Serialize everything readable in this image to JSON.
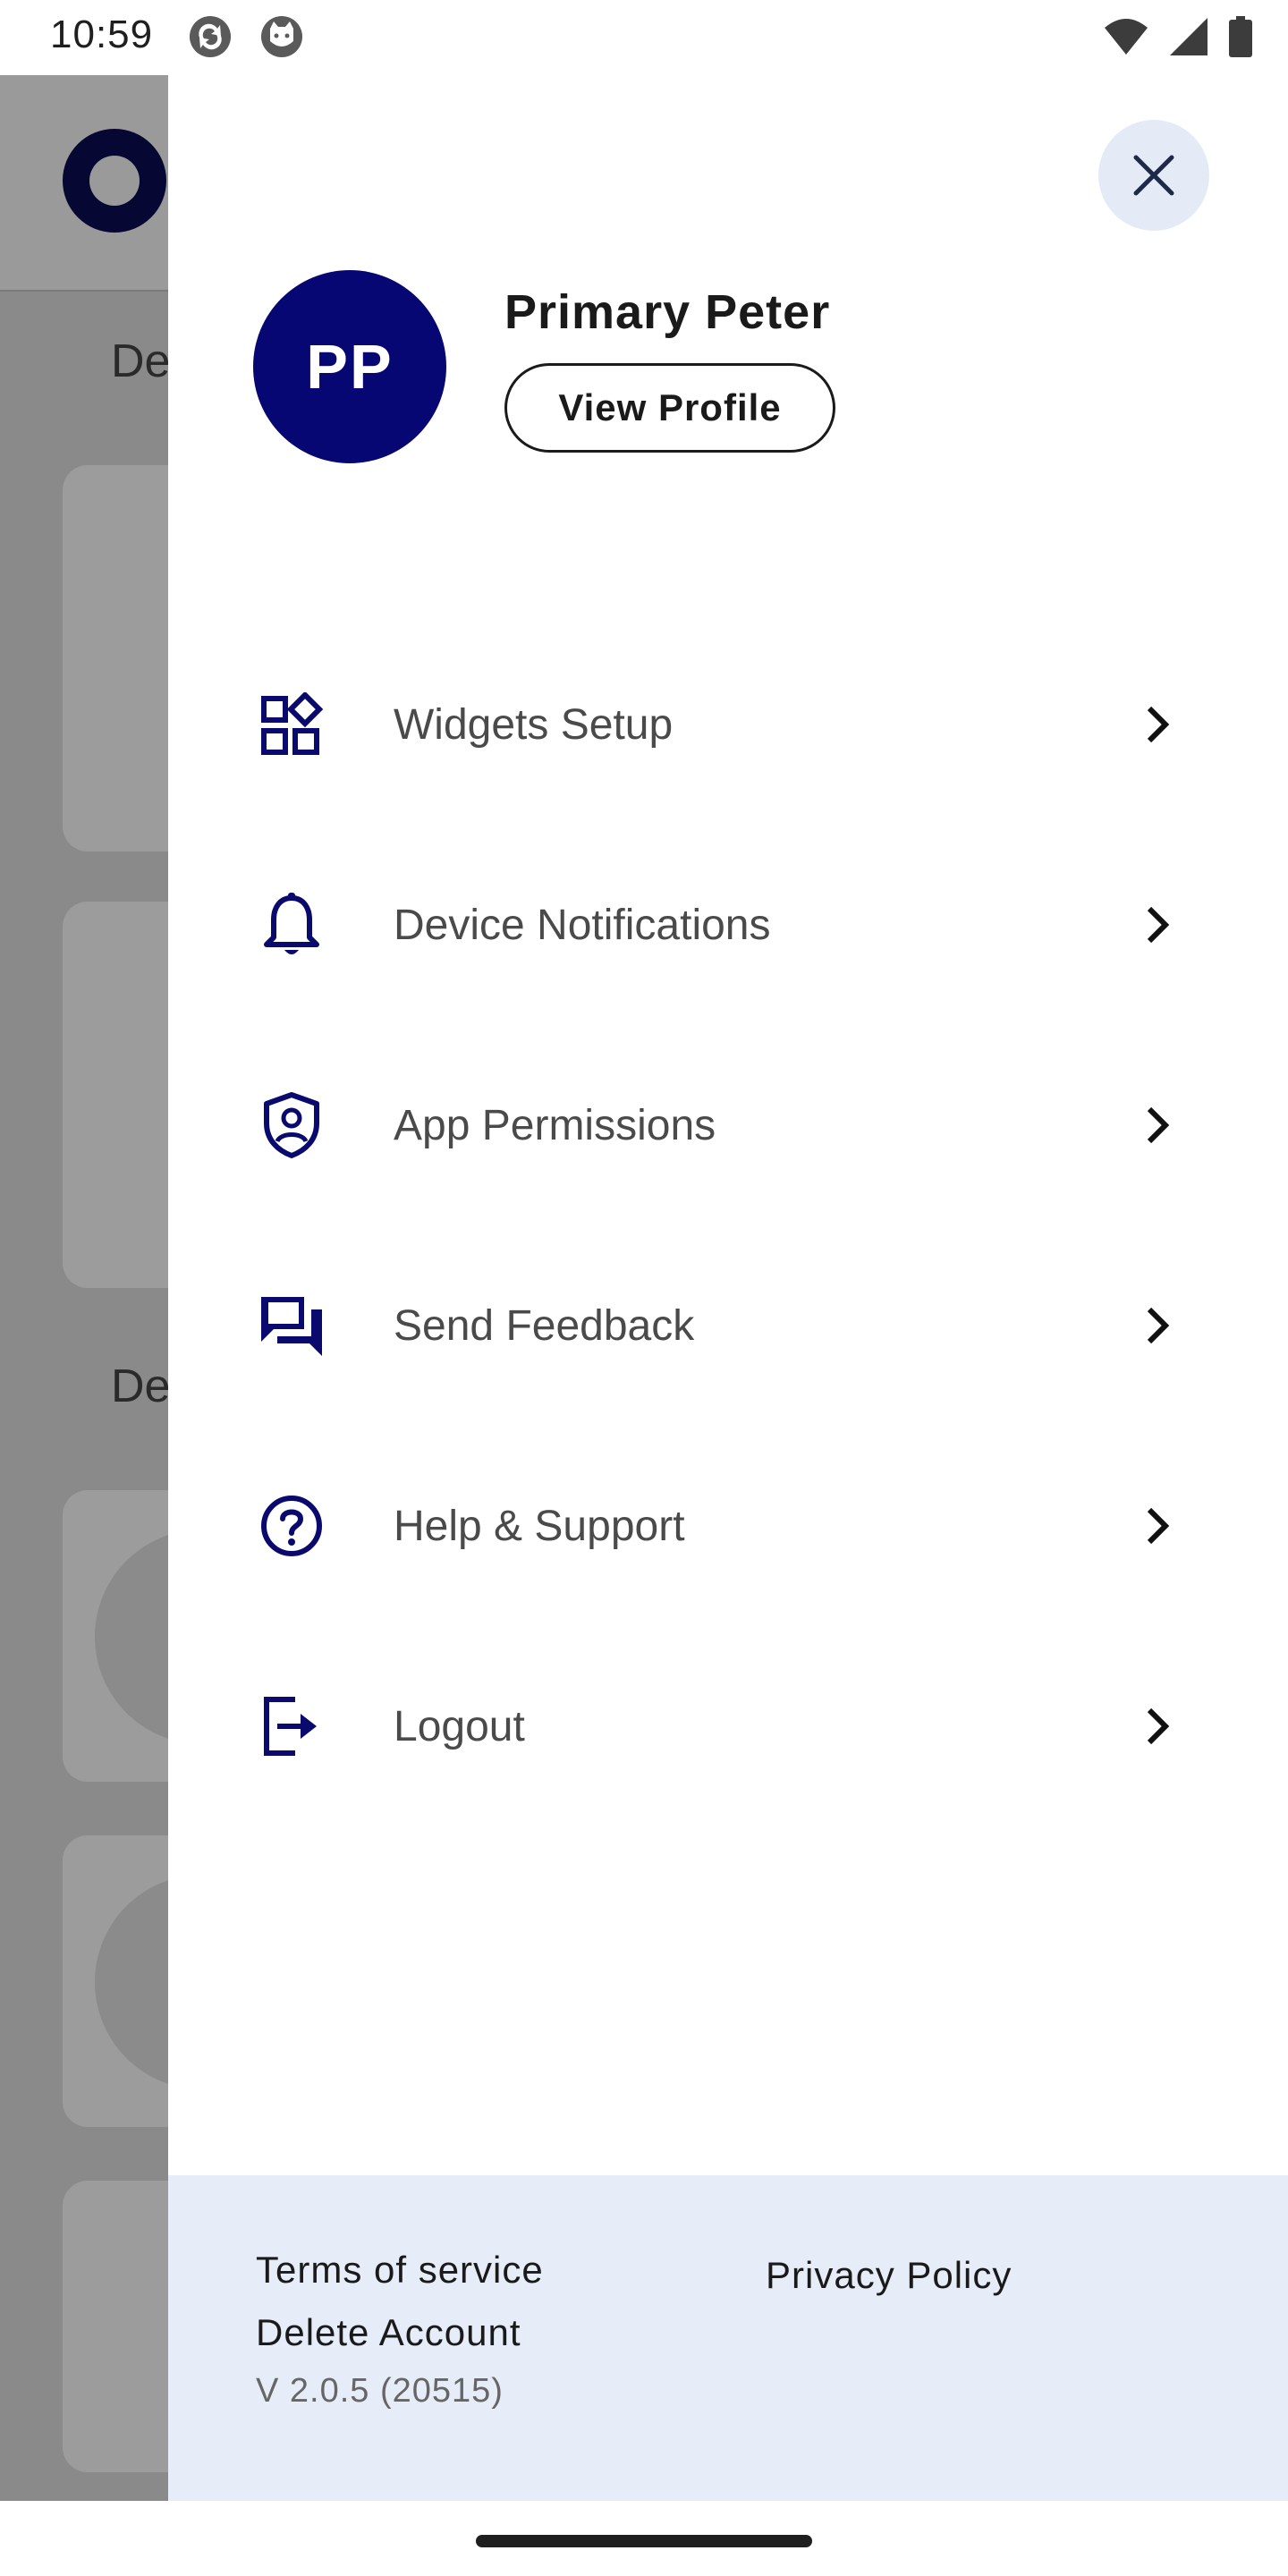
{
  "status_bar": {
    "time": "10:59",
    "icons": [
      "sync-app-icon",
      "cat-app-icon",
      "wifi-icon",
      "signal-icon",
      "battery-icon"
    ]
  },
  "background": {
    "section_1_text": "De",
    "section_2_text": "De"
  },
  "drawer": {
    "close_icon": "close-icon",
    "profile": {
      "initials": "PP",
      "name": "Primary Peter",
      "view_profile_label": "View Profile"
    },
    "menu": [
      {
        "label": "Widgets Setup",
        "icon": "widgets-icon"
      },
      {
        "label": "Device Notifications",
        "icon": "bell-icon"
      },
      {
        "label": "App Permissions",
        "icon": "shield-user-icon"
      },
      {
        "label": "Send Feedback",
        "icon": "forum-icon"
      },
      {
        "label": "Help & Support",
        "icon": "help-icon"
      },
      {
        "label": "Logout",
        "icon": "logout-icon"
      }
    ],
    "footer": {
      "terms": "Terms of service",
      "privacy": "Privacy Policy",
      "delete_account": "Delete Account",
      "version": "V 2.0.5 (20515)"
    }
  },
  "colors": {
    "brand_navy": "#070773",
    "close_bg": "#e4ebf7",
    "footer_bg": "#e6edf8",
    "scrim": "#8a8a8a"
  }
}
